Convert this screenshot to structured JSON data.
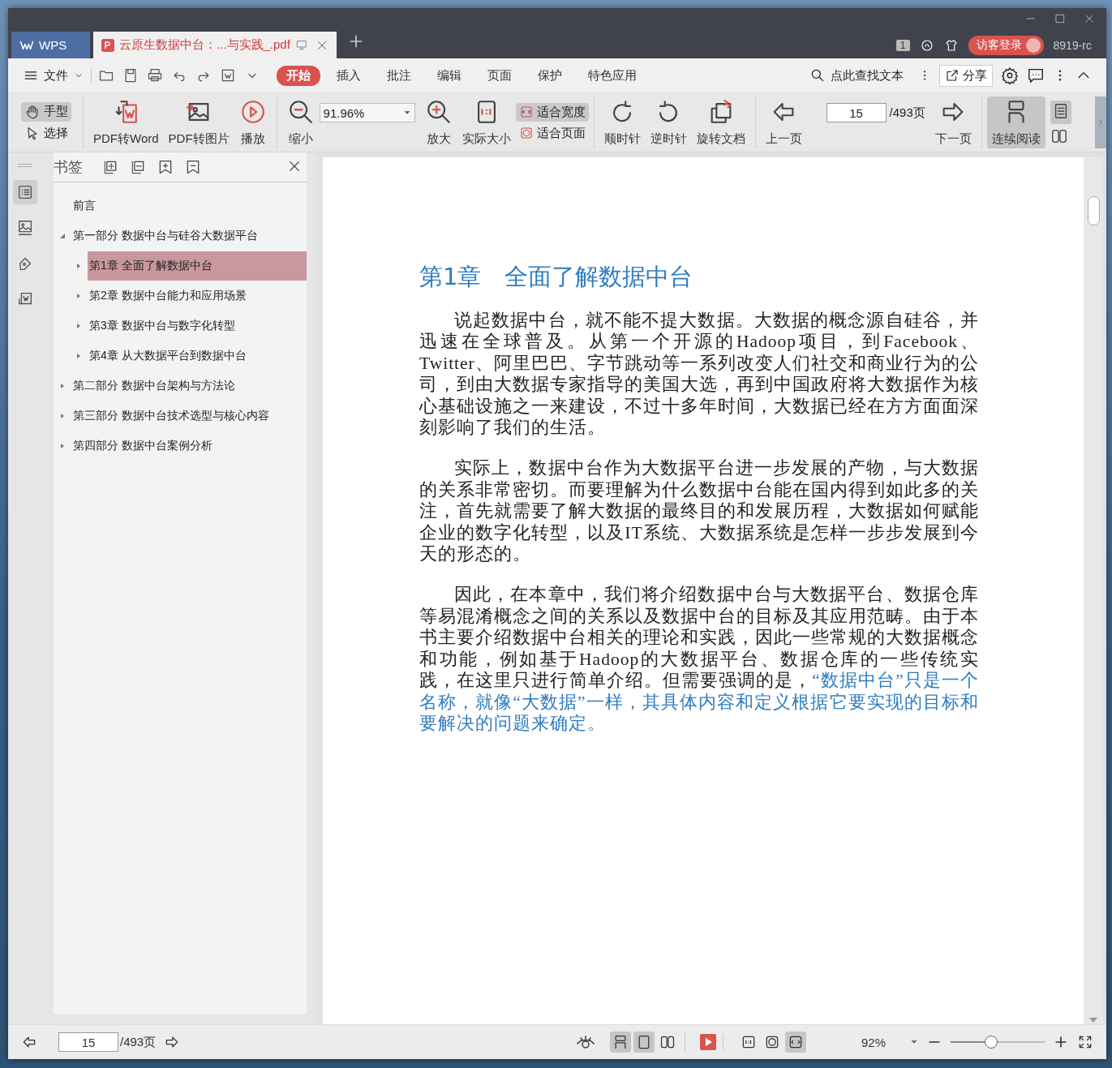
{
  "tabs": [
    {
      "kind": "home",
      "label": "WPS",
      "selected": false
    },
    {
      "kind": "document",
      "label": "云原生数据中台：...与实践_.pdf",
      "selected": true
    }
  ],
  "title_bar": {
    "window_count": "1",
    "login_button": "访客登录",
    "user": "8919-rc"
  },
  "menu": {
    "file": "文件",
    "tabs": [
      {
        "label": "开始",
        "selected": true
      },
      {
        "label": "插入",
        "selected": false
      },
      {
        "label": "批注",
        "selected": false
      },
      {
        "label": "编辑",
        "selected": false
      },
      {
        "label": "页面",
        "selected": false
      },
      {
        "label": "保护",
        "selected": false
      },
      {
        "label": "特色应用",
        "selected": false
      }
    ],
    "search": "点此查找文本",
    "share": "分享"
  },
  "toolbar": {
    "mode_tools": [
      {
        "label": "手型",
        "selected": true
      },
      {
        "label": "选择",
        "selected": false
      }
    ],
    "convert": [
      {
        "label": "PDF转Word"
      },
      {
        "label": "PDF转图片"
      },
      {
        "label": "播放"
      }
    ],
    "zoom_out": "缩小",
    "zoom_value": "91.96%",
    "zoom_in": "放大",
    "actual_size": "实际大小",
    "fit": [
      {
        "label": "适合宽度",
        "selected": true
      },
      {
        "label": "适合页面",
        "selected": false
      }
    ],
    "rotate": [
      {
        "label": "顺时针"
      },
      {
        "label": "逆时针"
      },
      {
        "label": "旋转文档"
      }
    ],
    "prev": "上一页",
    "page": "15",
    "page_total": "/493页",
    "next": "下一页",
    "continuous": {
      "label": "连续阅读",
      "selected": true
    }
  },
  "sidebar_tabs": [
    {
      "selected": true
    },
    {
      "selected": false
    },
    {
      "selected": false
    },
    {
      "selected": false
    }
  ],
  "bookmarks": {
    "title": "书签",
    "items": [
      {
        "label": "前言",
        "selected": false
      },
      {
        "label": "第一部分 数据中台与硅谷大数据平台",
        "expanded": true,
        "selected": false,
        "children": [
          {
            "label": "第1章 全面了解数据中台",
            "expanded": false,
            "selected": true
          },
          {
            "label": "第2章 数据中台能力和应用场景",
            "expanded": false,
            "selected": false
          },
          {
            "label": "第3章 数据中台与数字化转型",
            "expanded": false,
            "selected": false
          },
          {
            "label": "第4章 从大数据平台到数据中台",
            "expanded": false,
            "selected": false
          }
        ]
      },
      {
        "label": "第二部分 数据中台架构与方法论",
        "expanded": false,
        "selected": false
      },
      {
        "label": "第三部分 数据中台技术选型与核心内容",
        "expanded": false,
        "selected": false
      },
      {
        "label": "第四部分 数据中台案例分析",
        "expanded": false,
        "selected": false
      }
    ]
  },
  "document": {
    "heading": "第1章　全面了解数据中台",
    "paragraphs": [
      [
        {
          "text": "说起数据中台，就不能不提大数据。大数据的概念源自硅谷，并迅速在全球普及。从第一个开源的Hadoop项目，到Facebook、Twitter、阿里巴巴、字节跳动等一系列改变人们社交和商业行为的公司，到由大数据专家指导的美国大选，再到中国政府将大数据作为核心基础设施之一来建设，不过十多年时间，大数据已经在方方面面深刻影响了我们的生活。",
          "highlighted": false
        }
      ],
      [
        {
          "text": "实际上，数据中台作为大数据平台进一步发展的产物，与大数据的关系非常密切。而要理解为什么数据中台能在国内得到如此多的关注，首先就需要了解大数据的最终目的和发展历程，大数据如何赋能企业的数字化转型，以及IT系统、大数据系统是怎样一步步发展到今天的形态的。",
          "highlighted": false
        }
      ],
      [
        {
          "text": "因此，在本章中，我们将介绍数据中台与大数据平台、数据仓库等易混淆概念之间的关系以及数据中台的目标及其应用范畴。由于本书主要介绍数据中台相关的理论和实践，因此一些常规的大数据概念和功能，例如基于Hadoop的大数据平台、数据仓库的一些传统实践，在这里只进行简单介绍。但需要强调的是，",
          "highlighted": false
        },
        {
          "text": "“数据中台”只是一个名称，就像“大数据”一样，其具体内容和定义根据它要实现的目标和要解决的问题来确定。",
          "highlighted": true
        }
      ]
    ]
  },
  "status_bar": {
    "page": "15",
    "page_total": "/493页",
    "view_modes": [
      {
        "selected": true
      },
      {
        "selected": true
      },
      {
        "selected": false
      }
    ],
    "fit_modes": [
      {
        "selected": false
      },
      {
        "selected": false
      },
      {
        "selected": true
      }
    ],
    "zoom": "92%",
    "zoom_slider": {
      "level": 0.43
    }
  }
}
